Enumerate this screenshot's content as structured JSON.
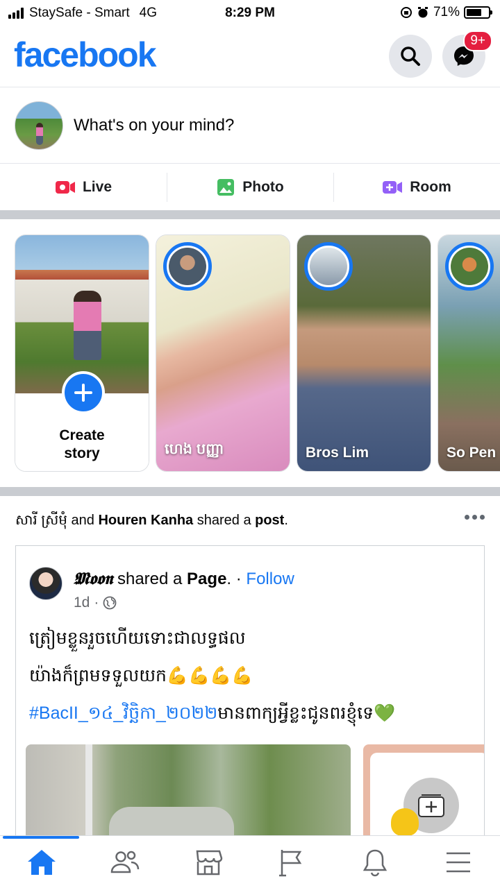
{
  "status_bar": {
    "carrier": "StaySafe - Smart",
    "network": "4G",
    "time": "8:29 PM",
    "battery_percent": "71%",
    "battery_level": 0.71
  },
  "header": {
    "logo": "facebook",
    "messenger_badge": "9+",
    "brand_color": "#1877f2"
  },
  "composer": {
    "placeholder": "What's on your mind?"
  },
  "actions": [
    {
      "label": "Live",
      "icon": "live-video-icon",
      "color": "#f02849"
    },
    {
      "label": "Photo",
      "icon": "photo-icon",
      "color": "#45bd62"
    },
    {
      "label": "Room",
      "icon": "room-video-icon",
      "color": "#9360f7"
    }
  ],
  "stories": {
    "create_label_1": "Create",
    "create_label_2": "story",
    "items": [
      {
        "name": "ហេង បញ្ញា"
      },
      {
        "name": "Bros Lim"
      },
      {
        "name": "So Pen"
      }
    ]
  },
  "post": {
    "shared_by_1": "សារី ស្រីមុំ",
    "and": " and ",
    "shared_by_2": "Houren Kanha",
    "shared_a": " shared a ",
    "post_word": "post",
    "period": ".",
    "author": "𝕸𝖔𝖔𝖓",
    "author_action": " shared a ",
    "page_word": "Page",
    "dot_sep": ". · ",
    "follow": "Follow",
    "time": "1d",
    "line1": "ត្រៀមខ្លួនរួចហើយទោះជាលទ្ធផល",
    "line2_text": "យ៉ាងក៏ព្រមទទួលយក",
    "line2_emoji": "💪💪💪💪",
    "hashtag": "#BacII_១៤_វិច្ឆិកា_២០២២",
    "line3_text": "មានពាក្យអ្វីខ្លះជូនពរខ្ញុំទេ",
    "line3_emoji": "💚"
  },
  "nav": {
    "items": [
      "home-icon",
      "friends-icon",
      "marketplace-icon",
      "pages-flag-icon",
      "notifications-bell-icon",
      "menu-icon"
    ],
    "active": "home-icon"
  }
}
